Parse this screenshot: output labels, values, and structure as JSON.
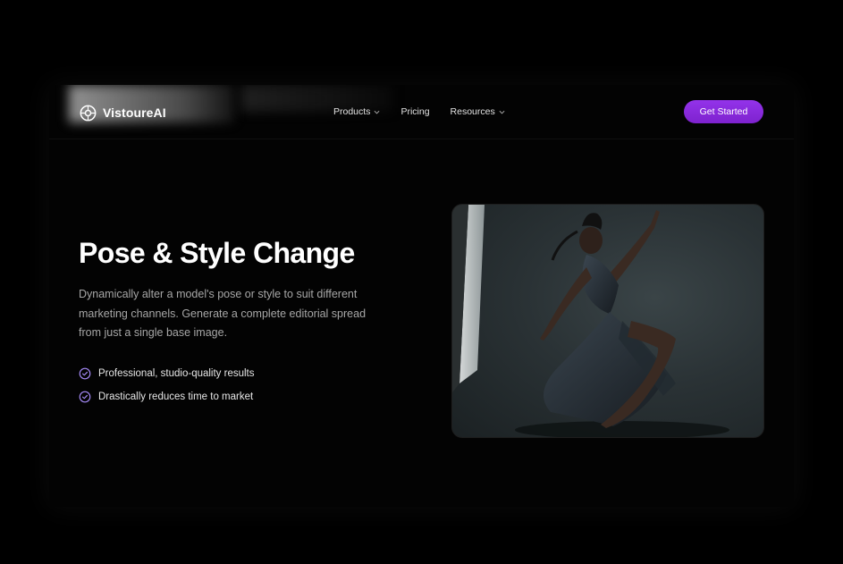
{
  "nav": {
    "brand": "VistoureAI",
    "items": [
      {
        "label": "Products",
        "has_dropdown": true
      },
      {
        "label": "Pricing",
        "has_dropdown": false
      },
      {
        "label": "Resources",
        "has_dropdown": true
      }
    ],
    "cta_label": "Get Started"
  },
  "hero": {
    "title": "Pose & Style Change",
    "description": "Dynamically alter a model's pose or style to suit different marketing channels. Generate a complete editorial spread from just a single base image.",
    "features": [
      "Professional, studio-quality results",
      "Drastically reduces time to market"
    ]
  },
  "colors": {
    "accent": "#9333ea",
    "check_icon": "#a78bfa",
    "background": "#000000"
  },
  "icons": {
    "logo": "aperture-icon",
    "dropdown": "chevron-down-icon",
    "feature": "check-circle-icon"
  }
}
